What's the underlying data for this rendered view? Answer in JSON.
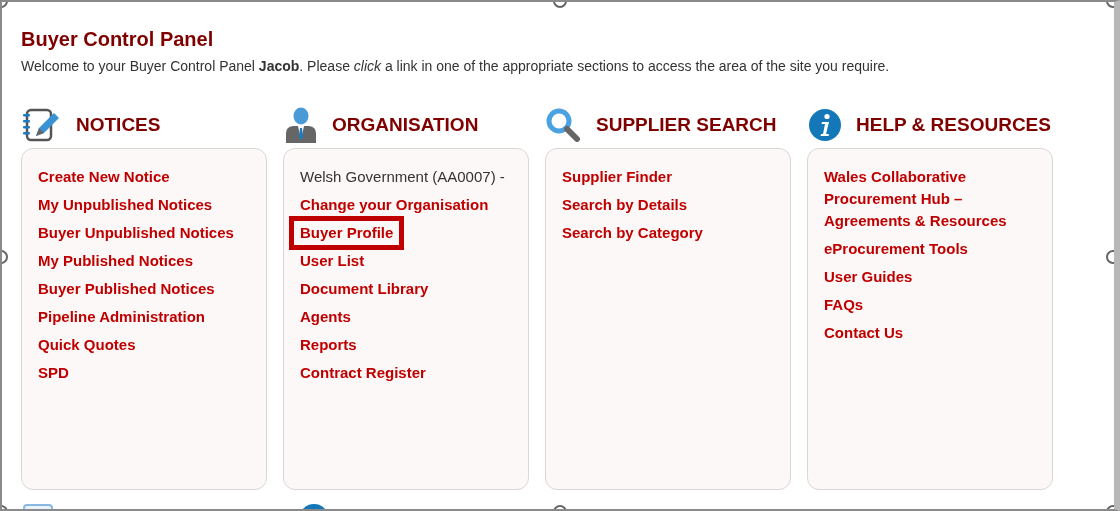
{
  "title": "Buyer Control Panel",
  "welcome": "Welcome to your Buyer Control Panel **Jacob**. Please *click* a link in one of the appropriate sections to access the area of the site you require.",
  "sections": [
    {
      "kind": "notices",
      "heading": "NOTICES",
      "items": [
        {
          "kind": "link",
          "label": "Create New Notice"
        },
        {
          "kind": "link",
          "label": "My Unpublished Notices"
        },
        {
          "kind": "link",
          "label": "Buyer Unpublished Notices"
        },
        {
          "kind": "link",
          "label": "My Published Notices"
        },
        {
          "kind": "link",
          "label": "Buyer Published Notices"
        },
        {
          "kind": "link",
          "label": "Pipeline Administration"
        },
        {
          "kind": "link",
          "label": "Quick Quotes"
        },
        {
          "kind": "link",
          "label": "SPD"
        }
      ]
    },
    {
      "kind": "organisation",
      "heading": "ORGANISATION",
      "items": [
        {
          "kind": "text",
          "label": "Welsh Government (AA0007) -"
        },
        {
          "kind": "link",
          "label": "Change your Organisation"
        },
        {
          "kind": "link",
          "label": "Buyer Profile",
          "highlighted": true
        },
        {
          "kind": "link",
          "label": "User List"
        },
        {
          "kind": "link",
          "label": "Document Library"
        },
        {
          "kind": "link",
          "label": "Agents"
        },
        {
          "kind": "link",
          "label": "Reports"
        },
        {
          "kind": "link",
          "label": "Contract Register"
        }
      ]
    },
    {
      "kind": "search",
      "heading": "SUPPLIER SEARCH",
      "items": [
        {
          "kind": "link",
          "label": "Supplier Finder"
        },
        {
          "kind": "link",
          "label": "Search by Details"
        },
        {
          "kind": "link",
          "label": "Search by Category"
        }
      ]
    },
    {
      "kind": "help",
      "heading": "HELP & RESOURCES",
      "items": [
        {
          "kind": "link",
          "label": "Wales Collaborative Procurement Hub – Agreements & Resources"
        },
        {
          "kind": "link",
          "label": "eProcurement Tools"
        },
        {
          "kind": "link",
          "label": "User Guides"
        },
        {
          "kind": "link",
          "label": "FAQs"
        },
        {
          "kind": "link",
          "label": "Contact Us"
        }
      ]
    }
  ]
}
